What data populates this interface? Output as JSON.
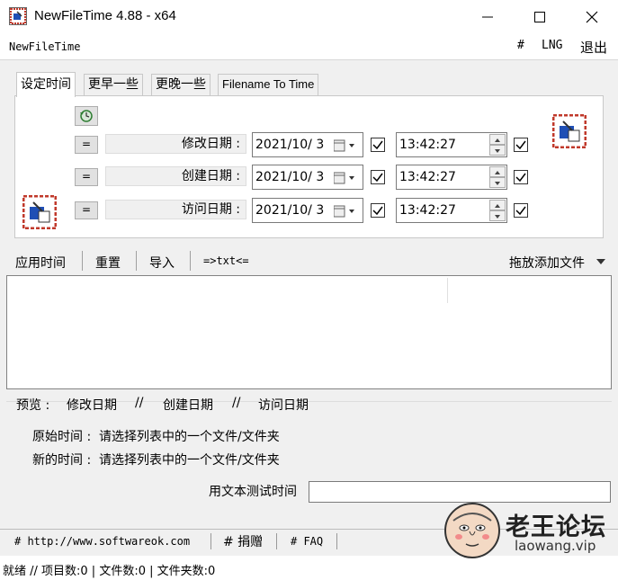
{
  "window": {
    "title": "NewFileTime 4.88 - x64",
    "minimize_glyph": "—",
    "maximize_glyph": "☐",
    "close_glyph": "✕"
  },
  "menu": {
    "app_name": "NewFileTime",
    "hash": "#",
    "lng": "LNG",
    "exit": "退出"
  },
  "tabs": [
    {
      "label": "设定时间",
      "active": true
    },
    {
      "label": "更早一些",
      "active": false
    },
    {
      "label": "更晚一些",
      "active": false
    },
    {
      "label": "Filename To Time",
      "active": false
    }
  ],
  "date_rows": [
    {
      "eq": "=",
      "label": "修改日期 :",
      "date": "2021/10/ 3",
      "date_checked": true,
      "time": "13:42:27",
      "time_checked": true
    },
    {
      "eq": "=",
      "label": "创建日期 :",
      "date": "2021/10/ 3",
      "date_checked": true,
      "time": "13:42:27",
      "time_checked": true
    },
    {
      "eq": "=",
      "label": "访问日期 :",
      "date": "2021/10/ 3",
      "date_checked": true,
      "time": "13:42:27",
      "time_checked": true
    }
  ],
  "toolbar": {
    "apply": "应用时间",
    "reset": "重置",
    "import": "导入",
    "to_txt": "=>txt<=",
    "drag_add": "拖放添加文件"
  },
  "preview": {
    "label": "预览 :",
    "modified": "修改日期",
    "sep1": "//",
    "created": "创建日期",
    "sep2": "//",
    "accessed": "访问日期",
    "original_label": "原始时间 :",
    "original_value": "请选择列表中的一个文件/文件夹",
    "new_label": "新的时间 :",
    "new_value": "请选择列表中的一个文件/文件夹",
    "test_label": "用文本测试时间",
    "test_value": ""
  },
  "links": {
    "website": "# http://www.softwareok.com",
    "donate": "# 捐赠",
    "faq": "# FAQ"
  },
  "status": {
    "text": "就绪 // 项目数:0 | 文件数:0 | 文件夹数:0"
  },
  "watermark": {
    "title": "老王论坛",
    "url": "laowang.vip"
  },
  "colors": {
    "check": "#000000",
    "icon_red": "#c0392b",
    "icon_blue": "#1f4fb5"
  }
}
